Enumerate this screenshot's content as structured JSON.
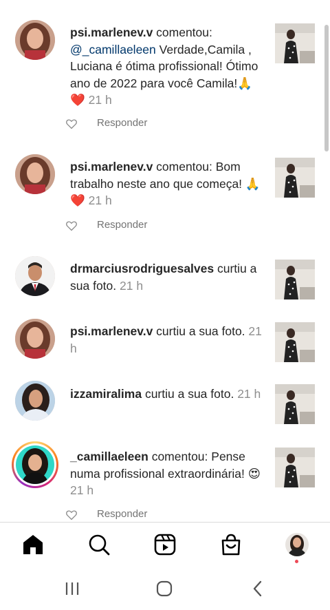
{
  "notifications": [
    {
      "user": "psi.marlenev.v",
      "verb": " comentou: ",
      "mention": "@_camillaeleen",
      "body": " Verdade,Camila , Luciana é ótima profissional! Ótimo ano de 2022 para você Camila!🙏❤️",
      "time": " 21 h",
      "reply_label": "Responder"
    },
    {
      "user": "psi.marlenev.v",
      "verb": " comentou: ",
      "body": "Bom trabalho neste ano que começa! 🙏❤️",
      "time": " 21 h",
      "reply_label": "Responder"
    },
    {
      "user": "drmarciusrodriguesalves",
      "verb": " curtiu a sua foto.",
      "time": " 21 h"
    },
    {
      "user": "psi.marlenev.v",
      "verb": " curtiu a sua foto.",
      "time": " 21 h"
    },
    {
      "user": "izzamiralima",
      "verb": " curtiu a sua foto.",
      "time": " 21 h"
    },
    {
      "user": "_camillaeleen",
      "verb": " comentou: ",
      "body": "Pense numa profissional extraordinária! 😍",
      "time": " 21 h",
      "reply_label": "Responder"
    }
  ],
  "icons": {
    "home": "home-icon",
    "search": "search-icon",
    "reels": "reels-icon",
    "shop": "shop-icon",
    "profile": "profile-avatar",
    "heart": "heart-outline-icon",
    "recents": "recents-icon",
    "home_nav": "home-circle-icon",
    "back": "back-chevron-icon"
  },
  "colors": {
    "text": "#262626",
    "secondary": "#8e8e8e",
    "mention": "#00376b",
    "notification_dot": "#ed4956"
  }
}
